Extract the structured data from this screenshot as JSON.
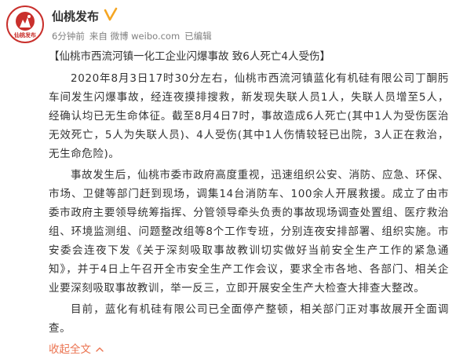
{
  "header": {
    "username": "仙桃发布",
    "avatar_text": "仙桃发布",
    "meta": {
      "time": "6分钟前",
      "source": "来自 微博 weibo.com",
      "edited": "已编辑"
    }
  },
  "post": {
    "title": "【仙桃市西流河镇一化工企业闪爆事故 致6人死亡4人受伤】",
    "paragraphs": [
      "2020年8月3日17时30分左右，仙桃市西流河镇蓝化有机硅有限公司丁酮肟车间发生闪爆事故，经连夜摸排搜救，新发现失联人员1人，失联人员增至5人，经确认均已无生命体征。截至8月4日7时，事故造成6人死亡(其中1人为受伤医治无效死亡，5人为失联人员)、4人受伤(其中1人伤情较轻已出院，3人正在救治，无生命危险)。",
      "事故发生后，仙桃市委市政府高度重视，迅速组织公安、消防、应急、环保、市场、卫健等部门赶到现场，调集14台消防车、100余人开展救援。成立了由市委市政府主要领导统筹指挥、分管领导牵头负责的事故现场调查处置组、医疗救治组、环境监测组、问题整改组等8个工作专班，分别连夜安排部署、组织实施。市安委会连夜下发《关于深刻吸取事故教训切实做好当前安全生产工作的紧急通知》，并于4日上午召开全市安全生产工作会议，要求全市各地、各部门、相关企业要深刻吸取事故教训，举一反三，立即开展安全生产大检查大排查大整改。",
      "目前，蓝化有机硅有限公司已全面停产整顿，相关部门正对事故展开全面调查。"
    ],
    "expand_label": "收起全文"
  },
  "colors": {
    "accent": "#eb7350",
    "verified": "#f5a623",
    "avatar_red": "#c9302c",
    "meta_gray": "#808080"
  },
  "icons": {
    "verified": "verified-badge-icon",
    "expand": "chevron-up-icon"
  }
}
